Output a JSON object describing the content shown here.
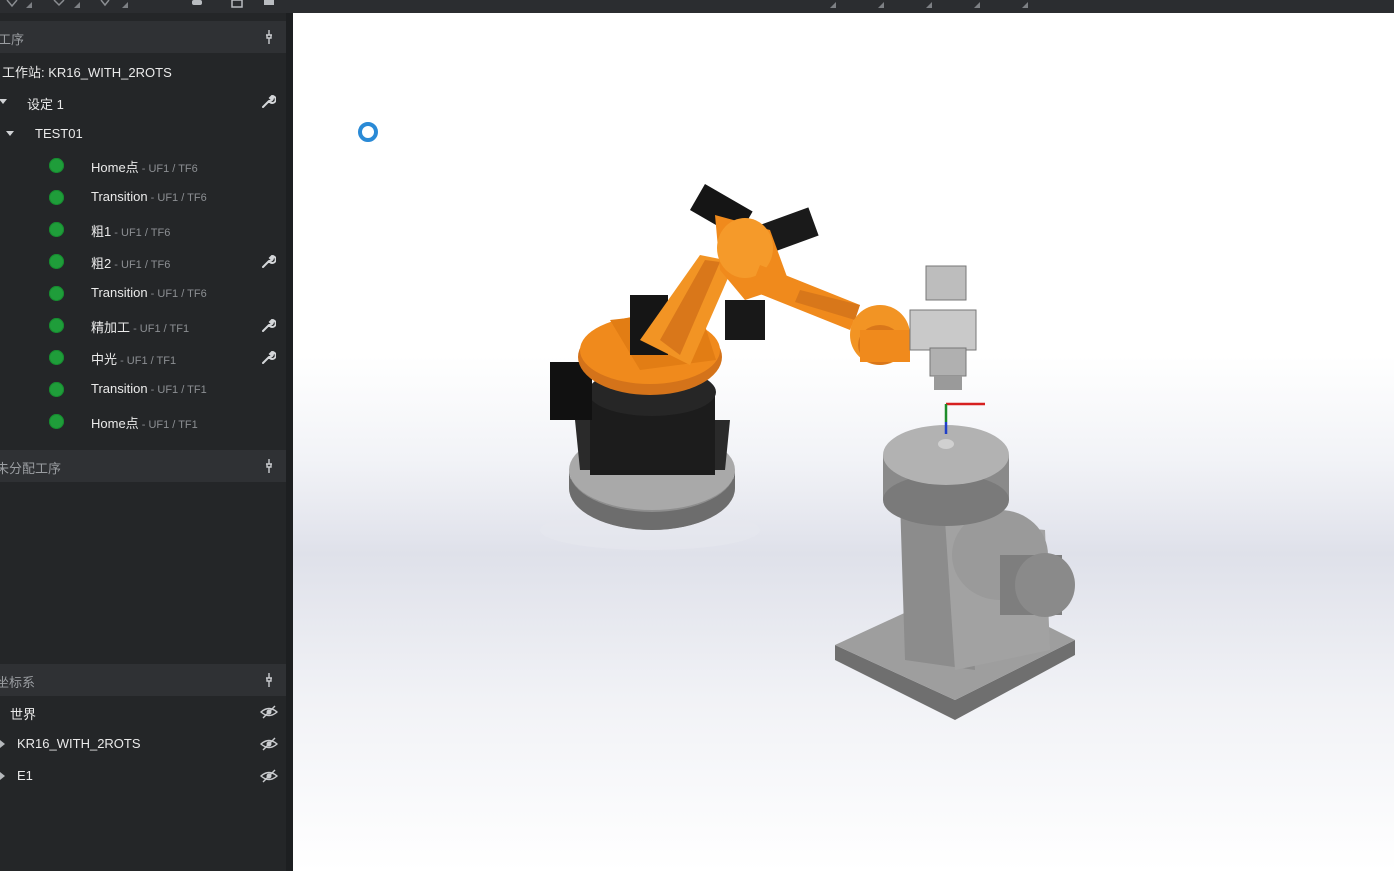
{
  "sections": {
    "operations_title": "工序",
    "unassigned_title": "未分配工序",
    "frames_title": "坐标系"
  },
  "station": {
    "label": "工作站: KR16_WITH_2ROTS"
  },
  "setup": {
    "label": "设定 1"
  },
  "program": {
    "label": "TEST01"
  },
  "operations": [
    {
      "name": "Home点",
      "frames": " - UF1 / TF6",
      "status": "ok",
      "has_wrench": false
    },
    {
      "name": "Transition",
      "frames": " - UF1 / TF6",
      "status": "ok",
      "has_wrench": false
    },
    {
      "name": "粗1",
      "frames": " - UF1 / TF6",
      "status": "ok",
      "has_wrench": false
    },
    {
      "name": "粗2",
      "frames": " - UF1 / TF6",
      "status": "ok",
      "has_wrench": true
    },
    {
      "name": "Transition",
      "frames": " - UF1 / TF6",
      "status": "ok",
      "has_wrench": false
    },
    {
      "name": "精加工",
      "frames": " - UF1 / TF1",
      "status": "ok",
      "has_wrench": true
    },
    {
      "name": "中光",
      "frames": " - UF1 / TF1",
      "status": "ok",
      "has_wrench": true
    },
    {
      "name": "Transition",
      "frames": " - UF1 / TF1",
      "status": "ok",
      "has_wrench": false
    },
    {
      "name": "Home点",
      "frames": " - UF1 / TF1",
      "status": "ok",
      "has_wrench": false
    }
  ],
  "frames": [
    {
      "name": "世界",
      "expandable": false
    },
    {
      "name": "KR16_WITH_2ROTS",
      "expandable": true
    },
    {
      "name": "E1",
      "expandable": true
    }
  ],
  "colors": {
    "status_ok": "#1f9d3a",
    "robot_orange": "#f08a1c",
    "cursor_blue": "#2a8ad6"
  }
}
